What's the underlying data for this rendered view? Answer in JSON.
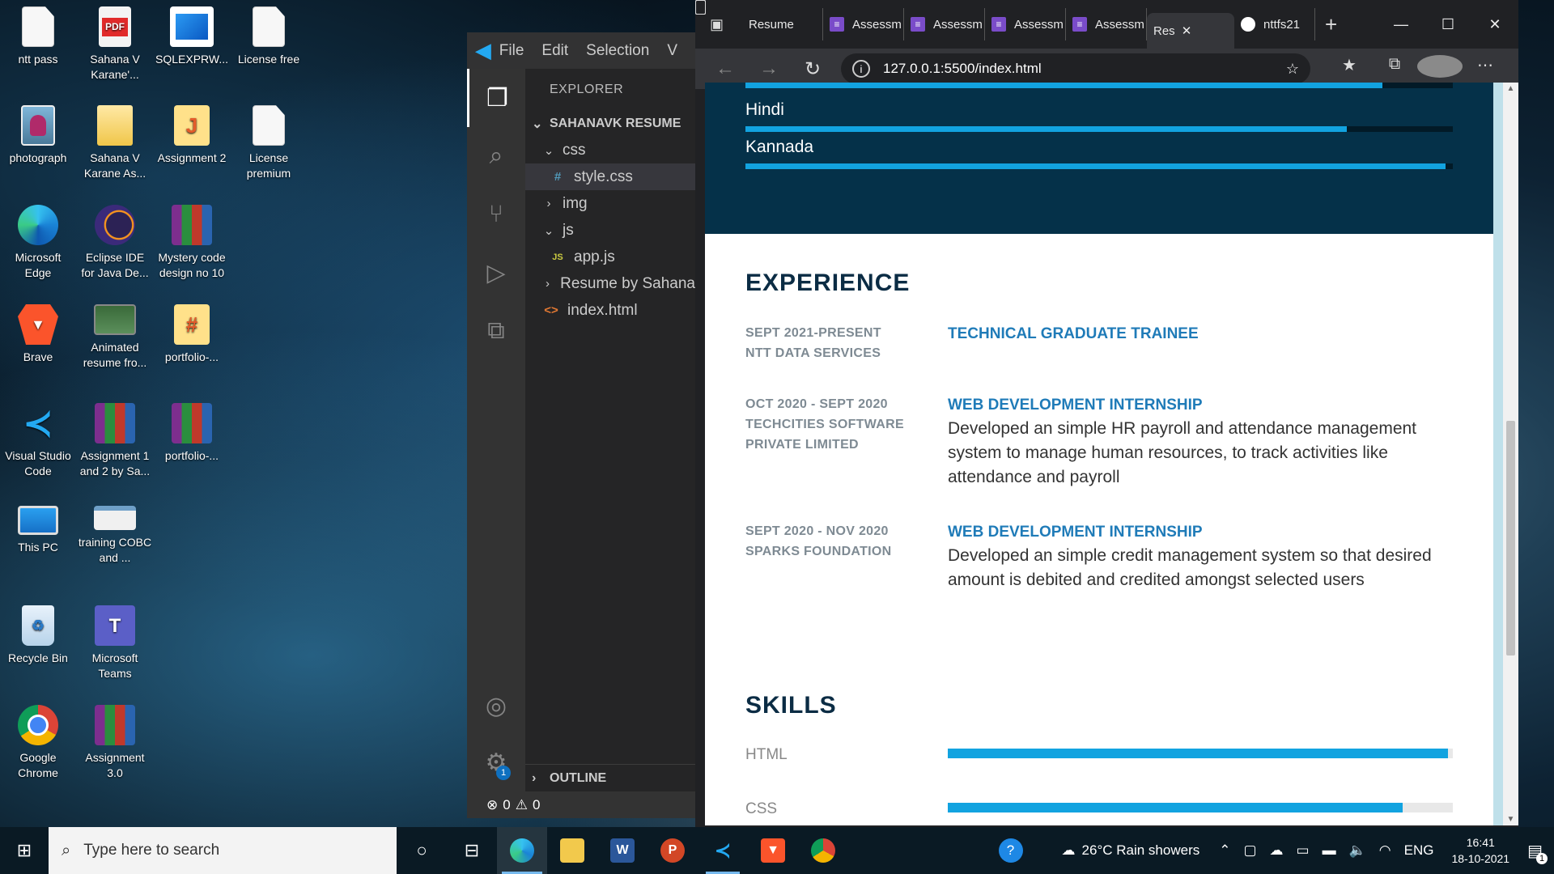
{
  "desktop": {
    "icons": [
      {
        "label": "ntt pass",
        "icon": "document-icon"
      },
      {
        "label": "Sahana V Karane'...",
        "icon": "pdf-icon",
        "badge": "PDF"
      },
      {
        "label": "SQLEXPRW...",
        "icon": "installer-icon"
      },
      {
        "label": "License free",
        "icon": "document-icon"
      },
      {
        "label": "photograph",
        "icon": "photo-icon"
      },
      {
        "label": "Sahana V Karane As...",
        "icon": "folder-icon"
      },
      {
        "label": "Assignment 2",
        "icon": "folder-icon"
      },
      {
        "label": "License premium",
        "icon": "document-icon"
      },
      {
        "label": "Microsoft Edge",
        "icon": "edge-icon"
      },
      {
        "label": "Eclipse IDE for Java De...",
        "icon": "eclipse-icon"
      },
      {
        "label": "Mystery code design no 10",
        "icon": "winrar-icon"
      },
      {
        "label": "Brave",
        "icon": "brave-icon"
      },
      {
        "label": "Animated resume fro...",
        "icon": "image-icon"
      },
      {
        "label": "portfolio-...",
        "icon": "folder-icon"
      },
      {
        "label": "Visual Studio Code",
        "icon": "vscode-icon"
      },
      {
        "label": "Assignment 1 and 2 by Sa...",
        "icon": "winrar-icon"
      },
      {
        "label": "portfolio-...",
        "icon": "winrar-icon"
      },
      {
        "label": "This PC",
        "icon": "computer-icon"
      },
      {
        "label": "training COBC and ...",
        "icon": "document-icon"
      },
      {
        "label": "Recycle Bin",
        "icon": "recycle-bin-icon"
      },
      {
        "label": "Microsoft Teams",
        "icon": "teams-icon"
      },
      {
        "label": "Google Chrome",
        "icon": "chrome-icon"
      },
      {
        "label": "Assignment 3.0",
        "icon": "winrar-icon"
      }
    ]
  },
  "vscode": {
    "menu": [
      "File",
      "Edit",
      "Selection",
      "V"
    ],
    "explorer_title": "EXPLORER",
    "workspace": "SAHANAVK RESUME",
    "tree": [
      {
        "label": "css",
        "kind": "folder-open",
        "depth": 0
      },
      {
        "label": "style.css",
        "kind": "css",
        "depth": 1,
        "selected": true
      },
      {
        "label": "img",
        "kind": "folder-closed",
        "depth": 0
      },
      {
        "label": "js",
        "kind": "folder-open",
        "depth": 0
      },
      {
        "label": "app.js",
        "kind": "js",
        "depth": 1
      },
      {
        "label": "Resume by Sahana",
        "kind": "folder-closed",
        "depth": 0
      },
      {
        "label": "index.html",
        "kind": "html",
        "depth": 0
      }
    ],
    "outline": "OUTLINE",
    "settings_badge": "1",
    "status": {
      "errors": "0",
      "warnings": "0"
    }
  },
  "browser": {
    "tabs": [
      {
        "label": "Resume",
        "icon": "page-icon"
      },
      {
        "label": "Assessm",
        "icon": "forms-icon"
      },
      {
        "label": "Assessm",
        "icon": "forms-icon"
      },
      {
        "label": "Assessm",
        "icon": "forms-icon"
      },
      {
        "label": "Assessm",
        "icon": "forms-icon"
      },
      {
        "label": "Res",
        "icon": "page-icon",
        "active": true
      },
      {
        "label": "nttfs21",
        "icon": "github-icon"
      }
    ],
    "url": "127.0.0.1:5500/index.html",
    "page": {
      "languages": [
        {
          "name": "Hindi",
          "level": 0.85
        },
        {
          "name": "Kannada",
          "level": 0.99
        }
      ],
      "top_bar_level": 0.9,
      "experience_title": "EXPERIENCE",
      "experience": [
        {
          "dates": "SEPT 2021-PRESENT",
          "org": "NTT DATA SERVICES",
          "role": "TECHNICAL GRADUATE TRAINEE",
          "desc": ""
        },
        {
          "dates": "OCT 2020 - SEPT 2020",
          "org": "TECHCITIES SOFTWARE PRIVATE LIMITED",
          "role": "WEB DEVELOPMENT INTERNSHIP",
          "desc": "Developed an simple HR payroll and attendance management system to manage human resources, to track activities like attendance and payroll"
        },
        {
          "dates": "SEPT 2020 - NOV 2020",
          "org": "SPARKS FOUNDATION",
          "role": "WEB DEVELOPMENT INTERNSHIP",
          "desc": "Developed an simple credit management system so that desired amount is debited and credited amongst selected users"
        }
      ],
      "skills_title": "SKILLS",
      "skills": [
        {
          "name": "HTML",
          "level": 0.99
        },
        {
          "name": "CSS",
          "level": 0.9
        }
      ]
    }
  },
  "taskbar": {
    "search_placeholder": "Type here to search",
    "weather": "26°C  Rain showers",
    "lang": "ENG",
    "time": "16:41",
    "date": "18-10-2021",
    "notifications": "1"
  }
}
